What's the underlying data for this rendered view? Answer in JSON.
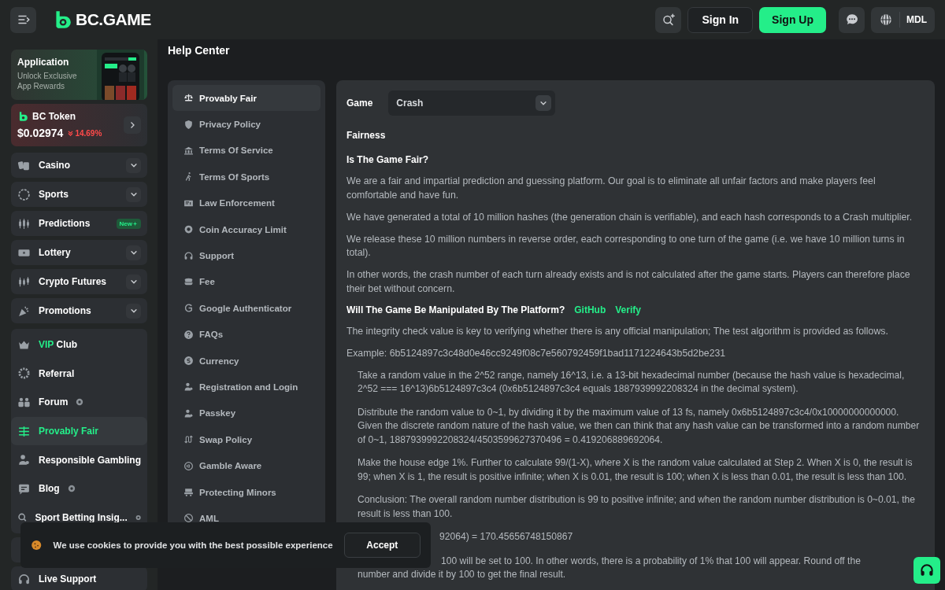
{
  "header": {
    "logo": "BC.GAME",
    "sign_in": "Sign In",
    "sign_up": "Sign Up",
    "currency": "MDL"
  },
  "sidebar": {
    "promo": {
      "title": "Application",
      "subtitle": "Unlock Exclusive App Rewards"
    },
    "token": {
      "name": "BC Token",
      "price": "$0.02974",
      "change": "14.69%"
    },
    "groups": [
      {
        "items": [
          {
            "label": "Casino",
            "expandable": true,
            "selected": false
          }
        ]
      },
      {
        "items": [
          {
            "label": "Sports",
            "expandable": true,
            "selected": false
          }
        ]
      },
      {
        "items": [
          {
            "label": "Predictions",
            "expandable": false,
            "badge": "New",
            "selected": false
          }
        ]
      },
      {
        "items": [
          {
            "label": "Lottery",
            "expandable": true,
            "selected": false
          }
        ]
      },
      {
        "items": [
          {
            "label": "Crypto Futures",
            "expandable": true,
            "selected": false
          }
        ]
      },
      {
        "items": [
          {
            "label": "Promotions",
            "expandable": true,
            "selected": false
          }
        ]
      },
      {
        "items": [
          {
            "highlight": "VIP",
            "label": "Club",
            "expandable": false,
            "selected": false
          },
          {
            "label": "Referral",
            "expandable": false,
            "selected": false
          },
          {
            "label": "Forum",
            "expandable": false,
            "marked": true,
            "selected": false
          },
          {
            "label": "Provably Fair",
            "expandable": false,
            "selected": true
          },
          {
            "label": "Responsible Gambling",
            "expandable": false,
            "selected": false
          },
          {
            "label": "Blog",
            "expandable": false,
            "marked": true,
            "selected": false
          },
          {
            "label": "Sport Betting Insig...",
            "expandable": false,
            "marked": true,
            "selected": false
          }
        ]
      },
      {
        "items": [
          {
            "label": "Live Support",
            "expandable": false,
            "selected": false
          }
        ]
      }
    ]
  },
  "page_title": "Help Center",
  "help_menu": [
    {
      "label": "Provably Fair",
      "selected": true
    },
    {
      "label": "Privacy Policy",
      "selected": false
    },
    {
      "label": "Terms Of Service",
      "selected": false
    },
    {
      "label": "Terms Of Sports",
      "selected": false
    },
    {
      "label": "Law Enforcement",
      "selected": false
    },
    {
      "label": "Coin Accuracy Limit",
      "selected": false
    },
    {
      "label": "Support",
      "selected": false
    },
    {
      "label": "Fee",
      "selected": false
    },
    {
      "label": "Google Authenticator",
      "selected": false
    },
    {
      "label": "FAQs",
      "selected": false
    },
    {
      "label": "Currency",
      "selected": false
    },
    {
      "label": "Registration and Login",
      "selected": false
    },
    {
      "label": "Passkey",
      "selected": false
    },
    {
      "label": "Swap Policy",
      "selected": false
    },
    {
      "label": "Gamble Aware",
      "selected": false
    },
    {
      "label": "Protecting Minors",
      "selected": false
    },
    {
      "label": "AML",
      "selected": false
    }
  ],
  "content": {
    "game_label": "Game",
    "game_value": "Crash",
    "blocks": [
      {
        "kind": "title",
        "text": "Fairness"
      },
      {
        "kind": "heading",
        "text": "Is The Game Fair?"
      },
      {
        "kind": "para",
        "text": "We are a fair and impartial prediction and guessing platform. Our goal is to eliminate all unfair factors and make players feel comfortable and have fun."
      },
      {
        "kind": "para",
        "text": "We have generated a total of 10 million hashes (the generation chain is verifiable), and each hash corresponds to a Crash multiplier."
      },
      {
        "kind": "para",
        "text": "We release these 10 million numbers in reverse order, each corresponding to one turn of the game (i.e. we have 10 million turns in total)."
      },
      {
        "kind": "para",
        "text": "In other words, the crash number of each turn already exists and is not calculated after the game starts. Players can therefore place their bet without concern."
      },
      {
        "kind": "heading",
        "text": "Will The Game Be Manipulated By The Platform?",
        "links": [
          "GitHub",
          "Verify"
        ]
      },
      {
        "kind": "para",
        "text": "The integrity check value is key to verifying whether there is any official manipulation; The test algorithm is provided as follows."
      },
      {
        "kind": "para",
        "text": "Example: 6b5124897c3c48d0e46cc9249f08c7e560792459f1bad1171224643b5d2be231"
      },
      {
        "kind": "step",
        "text": "Take a random value in the 2^52 range, namely 16^13, i.e. a 13-bit hexadecimal number (because the hash value is hexadecimal, 2^52 === 16^13)6b5124897c3c4 (0x6b5124897c3c4 equals 1887939992208324 in the decimal system)."
      },
      {
        "kind": "step",
        "text": "Distribute the random value to 0~1, by dividing it by the maximum value of 13 fs, namely 0x6b5124897c3c4/0x10000000000000. Given the discrete random nature of the hash value, we then can think that any hash value can be transformed into a random number of 0~1, 1887939992208324/4503599627370496 = 0.419206889692064."
      },
      {
        "kind": "step",
        "text": "Make the house edge 1%. Further to calculate 99/(1-X), where X is the random value calculated at Step 2. When X is 0, the result is 99; when X is 1, the result is positive infinite; when X is 0.01, the result is 100; when X is less than 0.01, the result is less than 100."
      },
      {
        "kind": "step",
        "text": "Conclusion: The overall random number distribution is 99 to positive infinite; and when the random number distribution is 0~0.01, the result is less than 100."
      },
      {
        "kind": "partial",
        "text": "92064) = 170.45656748150867"
      },
      {
        "kind": "partial",
        "text": "100 will be set to 100. In other words, there is a probability of 1% that 100 will appear. Round off the number and divide it by 100 to get the final result."
      }
    ]
  },
  "cookie": {
    "text": "We use cookies to provide you with the best possible experience",
    "accept": "Accept"
  }
}
